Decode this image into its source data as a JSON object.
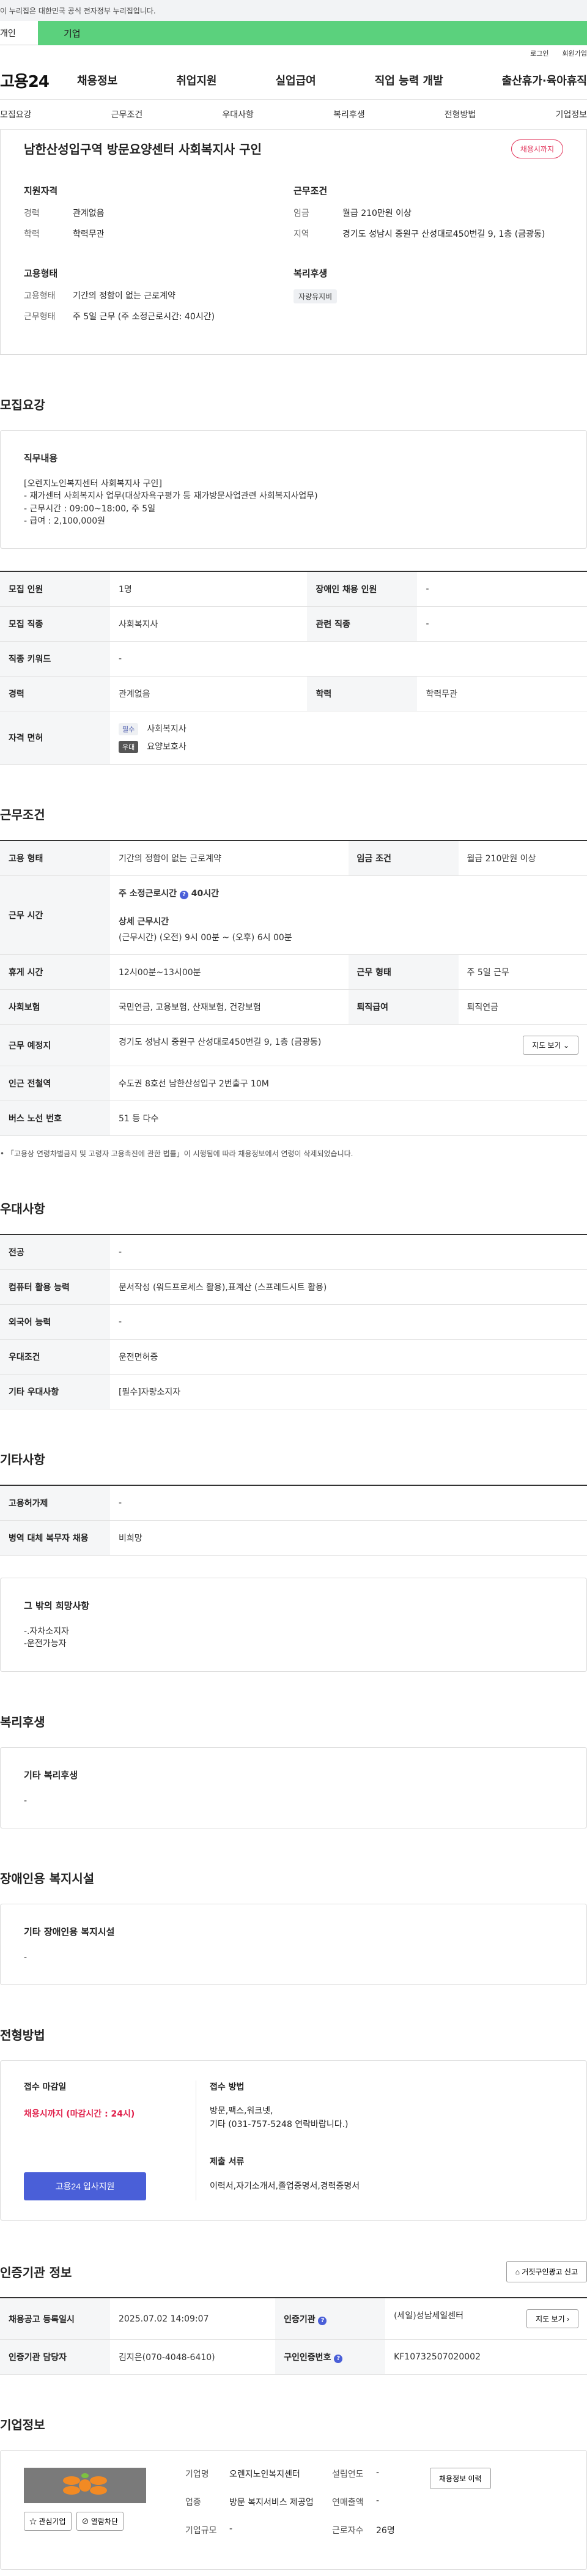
{
  "gov_notice": "이 누리집은 대한민국 공식 전자정부 누리집입니다.",
  "top_tabs": {
    "personal": "개인",
    "company": "기업"
  },
  "util": {
    "login": "로그인",
    "join": "회원가입"
  },
  "logo": "고용24",
  "gnb": [
    "채용정보",
    "취업지원",
    "실업급여",
    "직업 능력 개발",
    "출산휴가·육아휴직"
  ],
  "subnav": [
    "모집요강",
    "근무조건",
    "우대사항",
    "복리후생",
    "전형방법",
    "기업정보"
  ],
  "summary": {
    "title": "남한산성입구역 방문요양센터 사회복지사 구인",
    "badge": "채용시까지",
    "qual_h": "지원자격",
    "career_k": "경력",
    "career_v": "관계없음",
    "edu_k": "학력",
    "edu_v": "학력무관",
    "cond_h": "근무조건",
    "wage_k": "임금",
    "wage_v": "월급 210만원 이상",
    "region_k": "지역",
    "region_v": "경기도 성남시 중원구 산성대로450번길 9, 1층 (금광동)",
    "emp_h": "고용형태",
    "emptype_k": "고용형태",
    "emptype_v": "기간의 정함이 없는 근로계약",
    "worktype_k": "근무형태",
    "worktype_v": "주 5일 근무 (주 소정근로시간: 40시간)",
    "welfare_h": "복리후생",
    "welfare_tag": "자량유지비"
  },
  "recruit": {
    "h": "모집요강",
    "duty_h": "직무내용",
    "duty_text": "[오렌지노인복지센터 사회복지사 구인]\n - 재가센터 사회복지사 업무(대상자욕구평가 등 재가방문사업관련 사회복지사업무)\n - 근무시간 : 09:00~18:00, 주 5일\n - 급여 : 2,100,000원",
    "rows": {
      "count_k": "모집 인원",
      "count_v": "1명",
      "disabled_k": "장애인 채용 인원",
      "disabled_v": "-",
      "job_k": "모집 직종",
      "job_v": "사회복지사",
      "related_k": "관련 직종",
      "related_v": "-",
      "keyword_k": "직종 키워드",
      "keyword_v": "-",
      "career_k": "경력",
      "career_v": "관계없음",
      "edu_k": "학력",
      "edu_v": "학력무관",
      "license_k": "자격 면허",
      "lic1_tag": "필수",
      "lic1": "사회복지사",
      "lic2_tag": "우대",
      "lic2": "요양보호사"
    }
  },
  "work": {
    "h": "근무조건",
    "emptype_k": "고용 형태",
    "emptype_v": "기간의 정함이 없는 근로계약",
    "wage_k": "임금 조건",
    "wage_v": "월급 210만원 이상",
    "hours_k": "근무 시간",
    "hours_main": "주 소정근로시간",
    "hours_main_val": "40시간",
    "hours_detail_h": "상세 근무시간",
    "hours_detail": "(근무시간) (오전) 9시 00분 ~ (오후) 6시 00분",
    "break_k": "휴게 시간",
    "break_v": "12시00분~13시00분",
    "shape_k": "근무 형태",
    "shape_v": "주 5일 근무",
    "insurance_k": "사회보험",
    "insurance_v": "국민연금, 고용보험, 산재보험, 건강보험",
    "severance_k": "퇴직급여",
    "severance_v": "퇴직연금",
    "place_k": "근무 예정지",
    "place_v": "경기도 성남시 중원구 산성대로450번길 9, 1층 (금광동)",
    "map_btn": "지도 보기",
    "station_k": "인근 전철역",
    "station_v": "수도권 8호선 남한산성입구 2번출구 10M",
    "bus_k": "버스 노선 번호",
    "bus_v": "51 등 다수",
    "note": "「고용상 연령차별금지 및 고령자 고용촉진에 관한 법률」이 시행됨에 따라 채용정보에서 연령이 삭제되었습니다."
  },
  "pref": {
    "h": "우대사항",
    "major_k": "전공",
    "major_v": "-",
    "pc_k": "컴퓨터 활용 능력",
    "pc_v": "문서작성 (워드프로세스 활용),표계산 (스프레드시트 활용)",
    "lang_k": "외국어 능력",
    "lang_v": "-",
    "cond_k": "우대조건",
    "cond_v": "운전면허증",
    "etc_k": "기타 우대사항",
    "etc_v": "[필수]자량소지자"
  },
  "etc": {
    "h": "기타사항",
    "permit_k": "고용허가제",
    "permit_v": "-",
    "military_k": "병역 대체 복무자 채용",
    "military_v": "비희망",
    "wish_h": "그 밖의 희망사항",
    "wish_text": "-.자차소지자\n-운전가능자"
  },
  "welfare": {
    "h": "복리후생",
    "sub_h": "기타 복리후생",
    "text": "-"
  },
  "facility": {
    "h": "장애인용 복지시설",
    "sub_h": "기타 장애인용 복지시설",
    "text": "-"
  },
  "screening": {
    "h": "전형방법",
    "deadline_h": "접수 마감일",
    "deadline_v": "채용시까지 (마감시간 : 24시)",
    "apply_btn": "고용24 입사지원",
    "method_h": "접수 방법",
    "method_v": "방문,팩스,워크넷,\n기타 (031-757-5248 연락바랍니다.)",
    "docs_h": "제출 서류",
    "docs_v": "이력서,자기소개서,졸업증명서,경력증명서"
  },
  "cert": {
    "h": "인증기관 정보",
    "report_btn": "거짓구인광고 신고",
    "reg_k": "채용공고 등록일시",
    "reg_v": "2025.07.02 14:09:07",
    "agency_k": "인증기관",
    "agency_v": "(세일)성남세일센터",
    "map_btn": "지도 보기",
    "staff_k": "인증기관 담당자",
    "staff_v": "김지은(070-4048-6410)",
    "num_k": "구인인증번호",
    "num_v": "KF10732507020002"
  },
  "company": {
    "h": "기업정보",
    "fav_btn": "관심기업",
    "block_btn": "열람차단",
    "name_k": "기업명",
    "name_v": "오렌지노인복지센터",
    "year_k": "설립연도",
    "year_v": "-",
    "history_btn": "채용정보 이력",
    "industry_k": "업종",
    "industry_v": "방문 복지서비스 제공업",
    "sales_k": "연매출액",
    "sales_v": "-",
    "emp_k": "근로자수",
    "emp_v": "26명",
    "size_k": "기업규모",
    "size_v": "-"
  }
}
